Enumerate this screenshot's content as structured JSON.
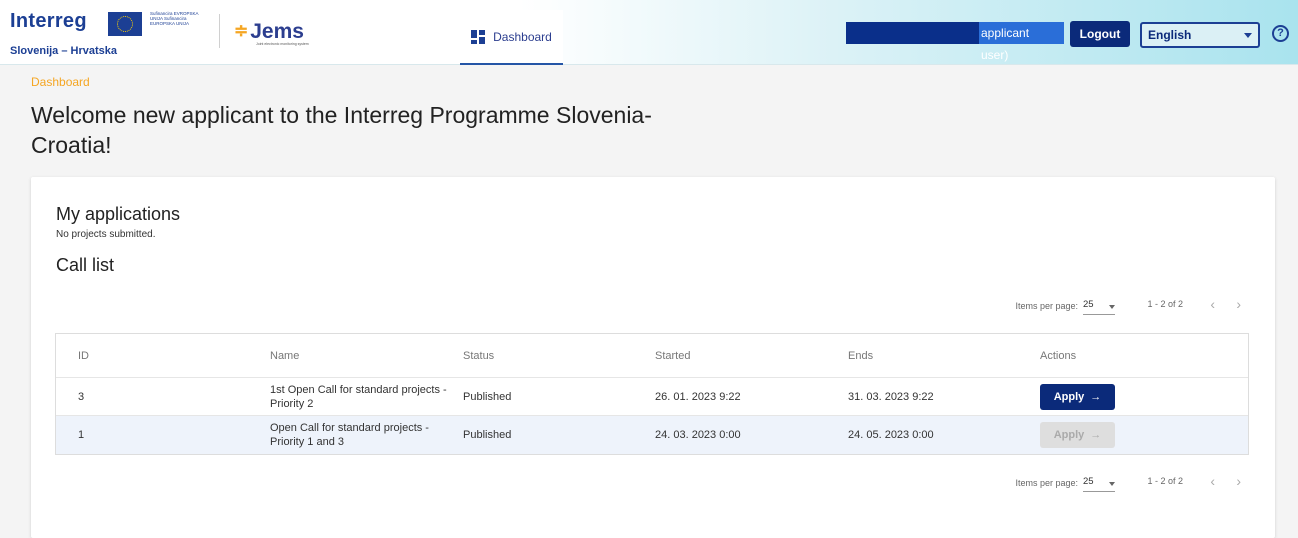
{
  "header": {
    "logo_text": "Interreg",
    "region_text": "Slovenija – Hrvatska",
    "eu_text": "Sufinancira EVROPSKA UNIJA Sufinancira EUROPSKA UNIJA",
    "jems_text": "Jems",
    "jems_tagline": "Joint electronic monitoring system",
    "tab_dashboard": "Dashboard",
    "user_label": "applicant user)",
    "logout_label": "Logout",
    "language": "English",
    "help_icon": "?"
  },
  "breadcrumb": "Dashboard",
  "page_title": "Welcome new applicant to the Interreg Programme Slovenia-Croatia!",
  "applications": {
    "title": "My applications",
    "note": "No projects submitted."
  },
  "call_list": {
    "title": "Call list",
    "paginator": {
      "items_per_page_label": "Items per page:",
      "items_per_page": "25",
      "range": "1 - 2 of 2",
      "prev": "‹",
      "next": "›"
    },
    "columns": [
      "ID",
      "Name",
      "Status",
      "Started",
      "Ends",
      "Actions"
    ],
    "rows": [
      {
        "id": "3",
        "name": "1st Open Call for standard projects - Priority 2",
        "status": "Published",
        "started": "26. 01. 2023 9:22",
        "ends": "31. 03. 2023 9:22",
        "action": "Apply",
        "action_enabled": true
      },
      {
        "id": "1",
        "name": "Open Call for standard projects - Priority 1 and 3",
        "status": "Published",
        "started": "24. 03. 2023 0:00",
        "ends": "24. 05. 2023 0:00",
        "action": "Apply",
        "action_enabled": false
      }
    ]
  },
  "colors": {
    "primary": "#0b2a7a",
    "accent": "#f5a623",
    "header_gradient_end": "#a9e3ee"
  }
}
